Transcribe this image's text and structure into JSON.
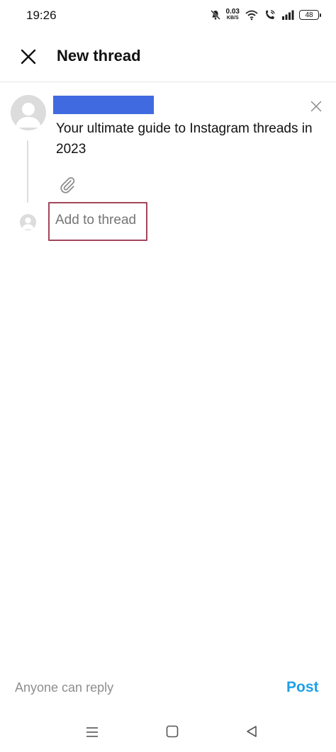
{
  "status_bar": {
    "time": "19:26",
    "net_speed_value": "0.03",
    "net_speed_unit": "KB/S",
    "battery": "48",
    "icons": [
      "mute-bell-icon",
      "wifi-icon",
      "wifi-call-icon",
      "signal-icon",
      "battery-icon"
    ]
  },
  "header": {
    "title": "New thread",
    "close_icon": "close-icon"
  },
  "compose": {
    "post_text": "Your ultimate guide to Instagram threads in 2023",
    "attach_icon": "paperclip-icon",
    "dismiss_icon": "close-icon",
    "username_redaction_color": "#3f6ae0",
    "add_to_thread_placeholder": "Add to thread",
    "highlight_color": "#a2455b"
  },
  "footer": {
    "reply_setting": "Anyone can reply",
    "post_label": "Post",
    "post_color": "#1fa0e9"
  },
  "nav_bar": {
    "icons": [
      "menu-icon",
      "home-square-icon",
      "back-triangle-icon"
    ]
  }
}
